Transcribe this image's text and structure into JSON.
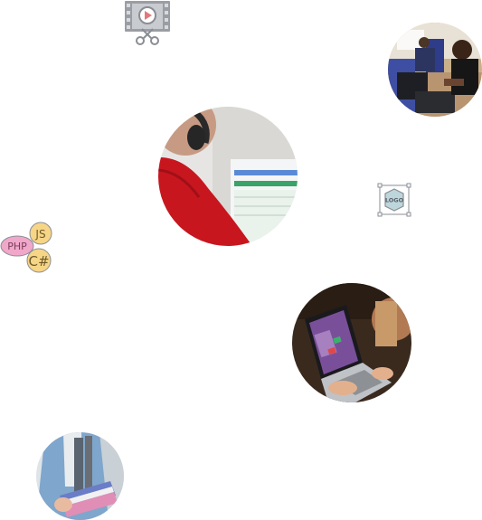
{
  "icons": {
    "video_edit": "video-edit-icon",
    "logo_design": "logo-design-icon",
    "code_languages": "code-languages-icon"
  },
  "logo_badge": {
    "text": "LOGO"
  },
  "code_badges": {
    "js": "JS",
    "php": "PHP",
    "csharp": "C#"
  },
  "colors": {
    "icon_gray": "#8a8e94",
    "icon_teal": "#bcd6dc",
    "js_badge": "#f6d586",
    "php_badge": "#f1a7c9",
    "csharp_badge": "#f6d586"
  }
}
